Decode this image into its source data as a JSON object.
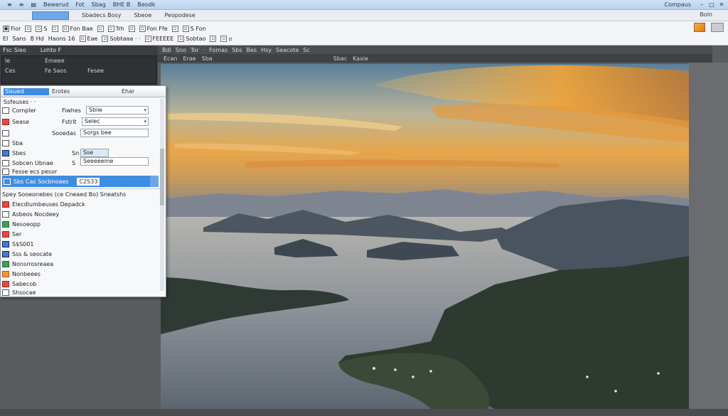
{
  "titlebar": {
    "menu": [
      "≡",
      "≡",
      "▤",
      "Bewerud",
      "Fot",
      "Sbag",
      "BHE B",
      "Beodk"
    ],
    "app_title": "Compaus",
    "controls": [
      "–",
      "□",
      "✕"
    ]
  },
  "tabs": {
    "items": [
      "Sbadecs Bosy",
      "Sbeoe",
      "Peopodese"
    ],
    "help": "Boln"
  },
  "ribbon": {
    "row1": [
      {
        "icon": "▣",
        "label": "Fior"
      },
      {
        "icon": "▫",
        "label": ""
      },
      {
        "icon": "▫",
        "label": "S"
      },
      {
        "icon": "▫",
        "label": ""
      },
      {
        "icon": "▫",
        "label": "Fon Bae"
      },
      {
        "icon": "▫",
        "label": ""
      },
      {
        "icon": "▫",
        "label": "Trh"
      },
      {
        "icon": "▫",
        "label": ""
      },
      {
        "icon": "▫",
        "label": "Fon Ffe"
      },
      {
        "icon": "▫",
        "label": ""
      },
      {
        "icon": "▫",
        "label": "S Fon"
      }
    ],
    "row2": [
      {
        "icon": "",
        "label": "EI"
      },
      {
        "icon": "",
        "label": "Sans"
      },
      {
        "icon": "",
        "label": "B Hd"
      },
      {
        "icon": "",
        "label": "Haons 16"
      },
      {
        "icon": "▫",
        "label": "Eae"
      },
      {
        "icon": "▫",
        "label": "Sobtaaa · ·"
      },
      {
        "icon": "▫",
        "label": "FEEEEE"
      },
      {
        "icon": "▫",
        "label": "Sobtao"
      },
      {
        "icon": "▫",
        "label": ""
      },
      {
        "icon": "▫",
        "label": "▫"
      }
    ]
  },
  "left_panel": {
    "heads": [
      "Fsc Sieo",
      "Lohto F"
    ],
    "cells": [
      "Ie",
      "Emeee",
      "Ces",
      "Fe Saos",
      "Fesee"
    ]
  },
  "doc_tabs": {
    "row1": [
      "Bdi",
      "Sno",
      "Tor",
      "·",
      "Fomas",
      "Sbs",
      "Bes",
      "Hsy",
      "Seacote",
      "Sc"
    ],
    "row2": [
      "Ecan",
      "Erae",
      "Sba"
    ],
    "row2_right": [
      "Sbac",
      "Kaxie"
    ]
  },
  "dialog": {
    "title_tab": "Sisued",
    "title_mid": "Erotes",
    "title_right": "Ehar",
    "subtitle": "Ssfeuses · ·",
    "rows": [
      {
        "label": "Compler",
        "value": "Fiwhes",
        "field": "Sbiw"
      },
      {
        "label": "Sease",
        "value": "Fstrit",
        "field": "Selec"
      },
      {
        "label": "",
        "value": "Sooedas",
        "field": "Sorgs bee"
      },
      {
        "label": "Sba",
        "value": "",
        "field": ""
      },
      {
        "label": "Sbes",
        "value": "Sn",
        "field": "Sse"
      },
      {
        "label": "Sobcen Ubnae",
        "value": "S",
        "field": "Seeeeeme"
      },
      {
        "label": "Fesse ecs pesor",
        "value": "",
        "field": ""
      }
    ],
    "selected": {
      "label": "Sbs Cas  Socbnoaes",
      "value": "C2S33"
    },
    "list_header": "Spey Sooeonebes (ce Cneaed Bo) Sneatshs",
    "list": [
      {
        "color": "red",
        "label": "Elecdlumbeuses Depadck"
      },
      {
        "color": "",
        "label": "Asbeos Nocdeey"
      },
      {
        "color": "green",
        "label": "Nesoeopp"
      },
      {
        "color": "red",
        "label": "Ser"
      },
      {
        "color": "blue",
        "label": "S$S001"
      },
      {
        "color": "blue",
        "label": "Sss & seocate"
      },
      {
        "color": "green",
        "label": "Nonsrrosreaea"
      },
      {
        "color": "orange",
        "label": "Nonbeees"
      },
      {
        "color": "red",
        "label": "Sabecob"
      },
      {
        "color": "",
        "label": "Shsocae"
      }
    ]
  }
}
